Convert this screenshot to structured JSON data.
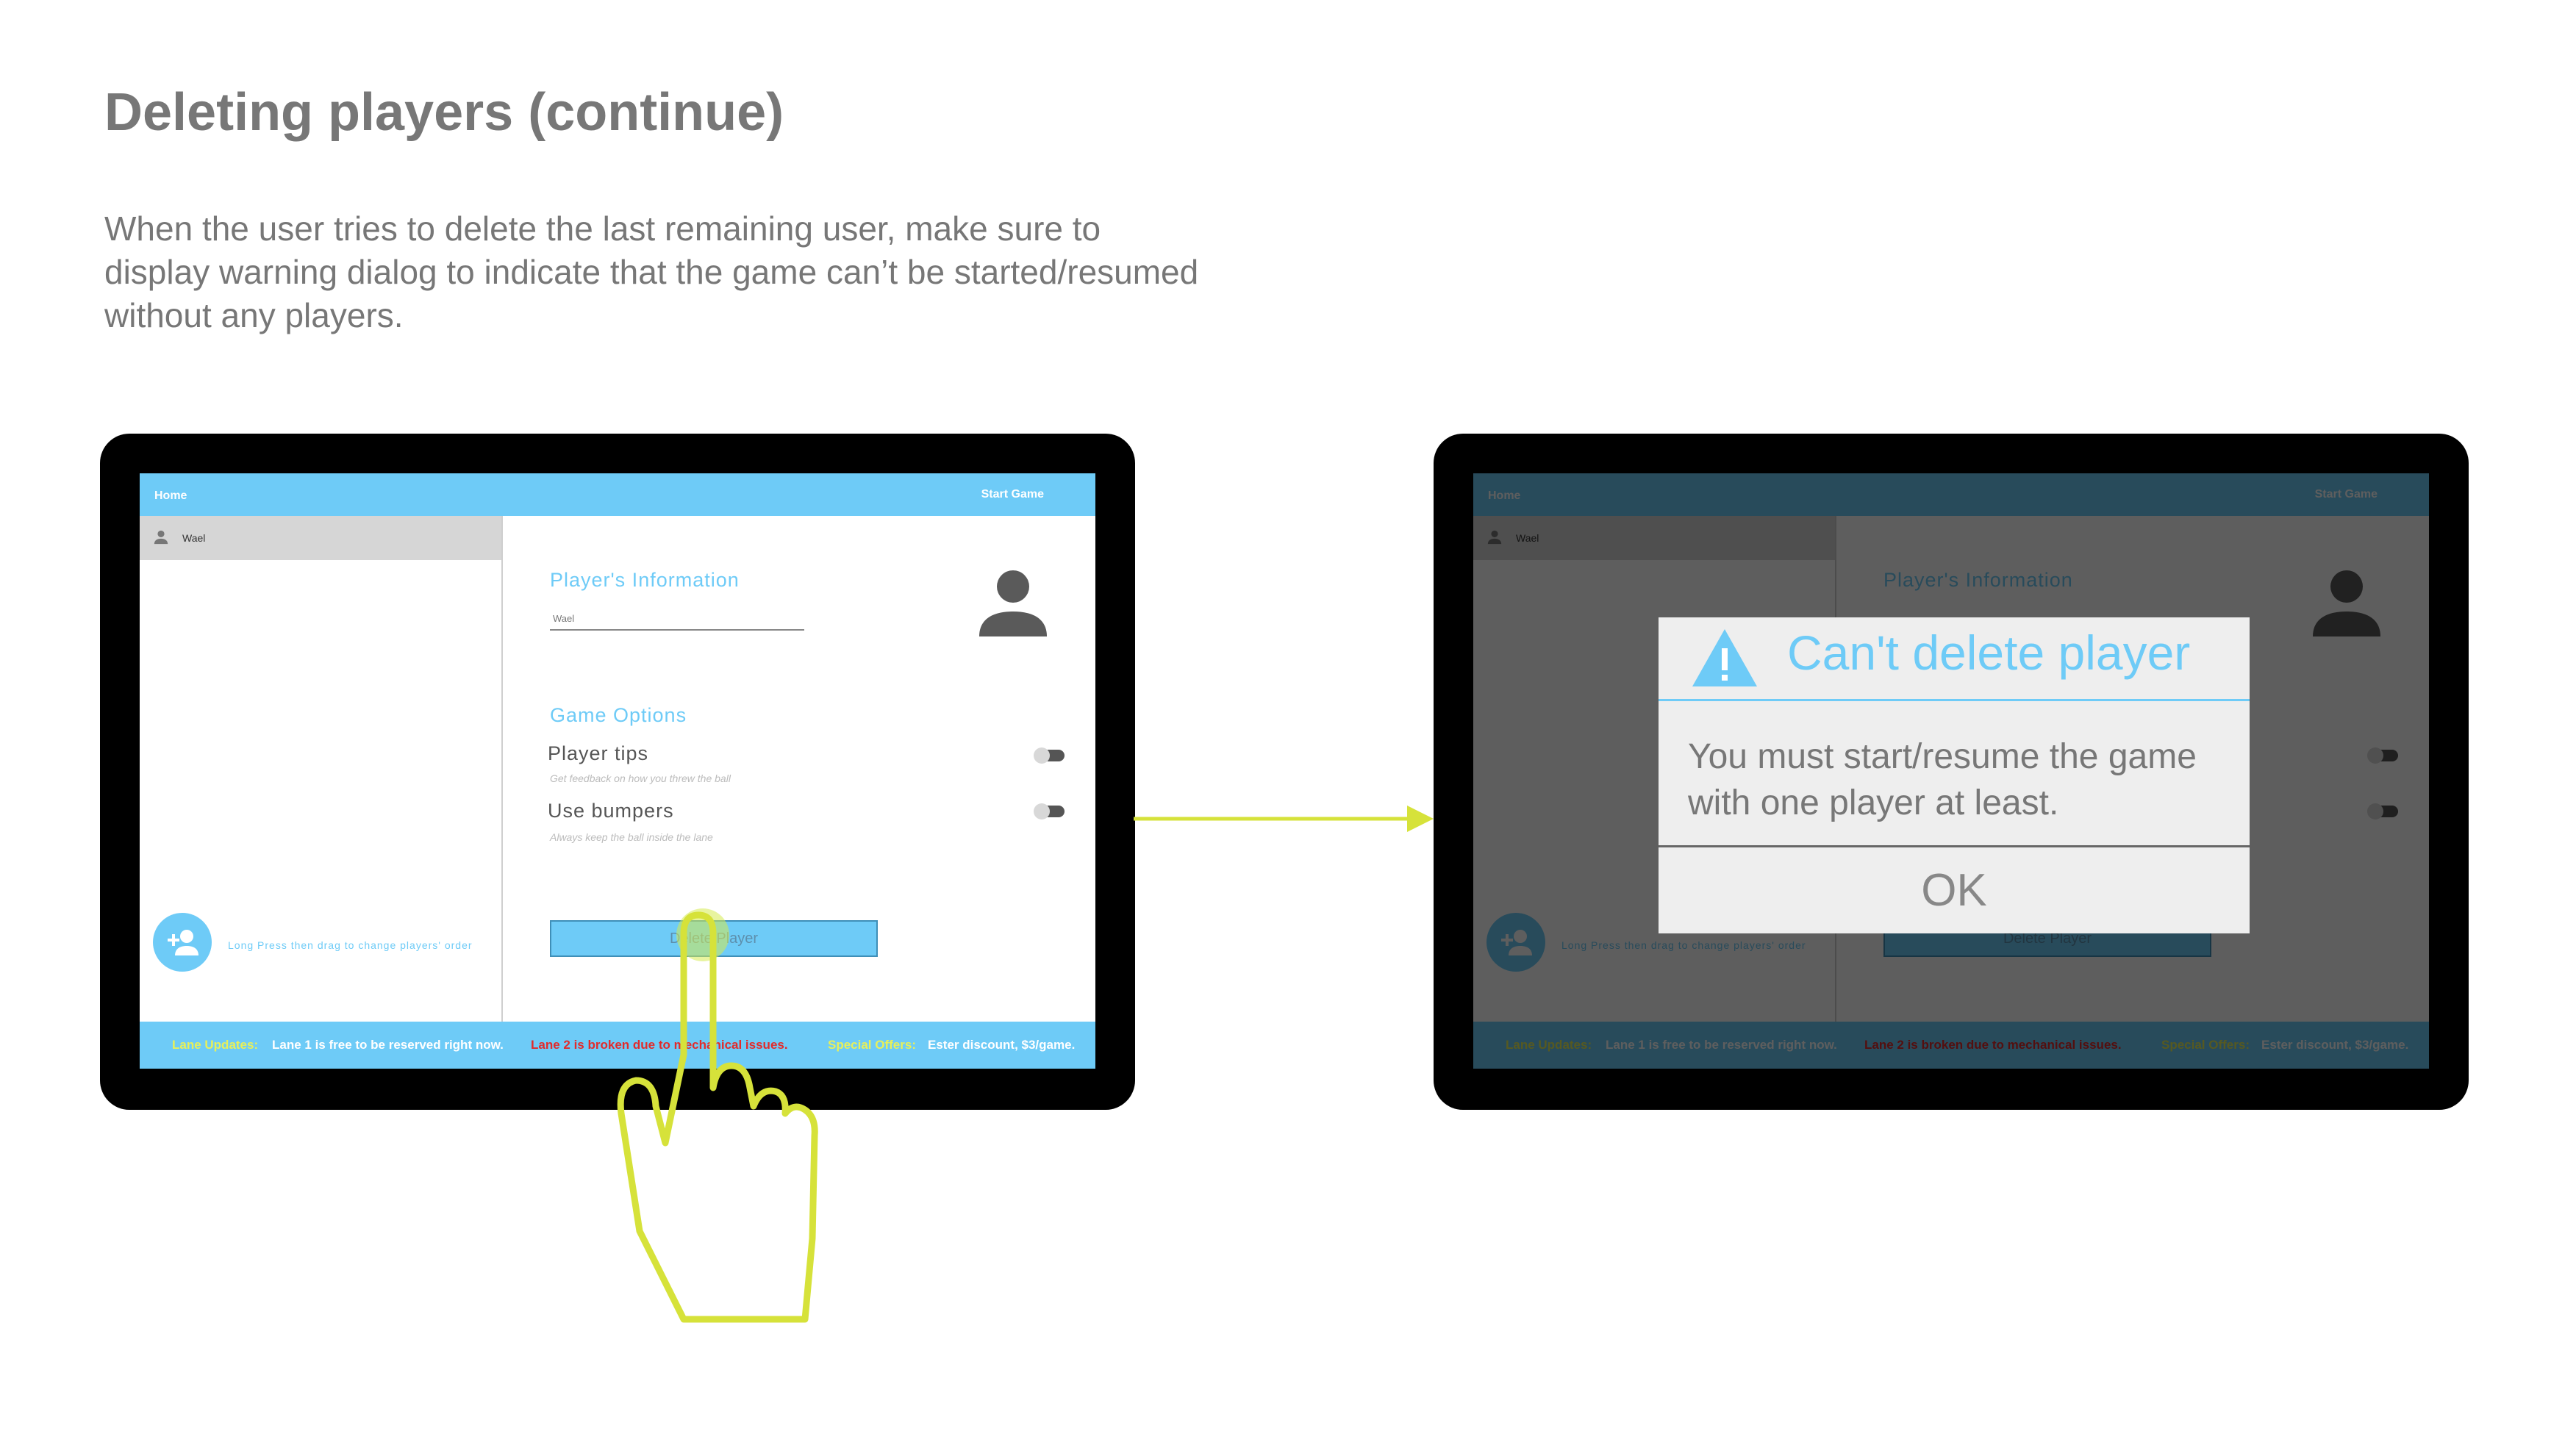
{
  "slide": {
    "title": "Deleting players (continue)",
    "description": "When the user tries to delete the last remaining user, make sure to display warning dialog to indicate that the game can’t be started/resumed without any players."
  },
  "app": {
    "home_label": "Home",
    "start_game_label": "Start Game",
    "player_name": "Wael",
    "add_player_hint": "Long Press then drag to change players' order",
    "players_info_heading": "Player's Information",
    "name_field_value": "Wael",
    "game_options_heading": "Game Options",
    "options": [
      {
        "label": "Player tips",
        "description": "Get feedback on how you threw the ball",
        "enabled": true
      },
      {
        "label": "Use bumpers",
        "description": "Always keep the ball inside the lane",
        "enabled": true
      }
    ],
    "delete_button_label": "Delete Player",
    "ticker": {
      "lane_updates_label": "Lane Updates:",
      "lane1_text": "Lane 1 is free to be reserved right now.",
      "lane2_text": "Lane 2 is broken due to mechanical issues.",
      "special_offers_label": "Special Offers:",
      "offer_text": "Ester  discount, $3/game."
    }
  },
  "dialog": {
    "title": "Can't delete player",
    "message": "You must start/resume the game with one player at least.",
    "ok_label": "OK",
    "icon": "warning-icon"
  },
  "colors": {
    "accent": "#6ecbf7",
    "annotation": "#d6e23a",
    "ticker_highlight": "#e8f05a",
    "ticker_alert": "#e22b2b"
  }
}
